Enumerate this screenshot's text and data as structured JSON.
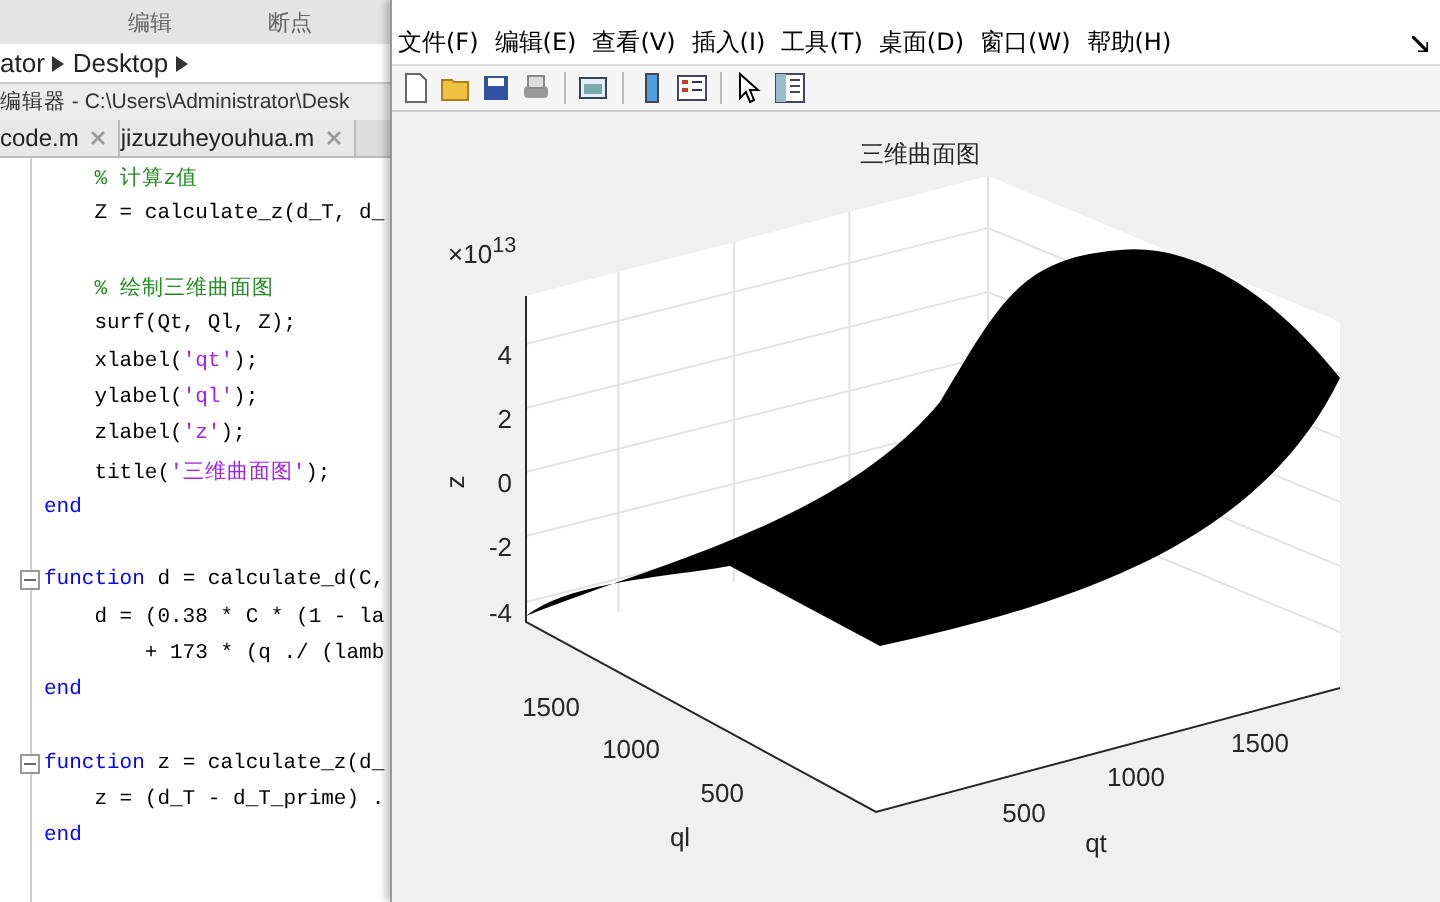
{
  "editor": {
    "toolstrip_sections": [
      "编辑",
      "断点"
    ],
    "breadcrumb": [
      "ator",
      "Desktop"
    ],
    "title": "编辑器 - C:\\Users\\Administrator\\Desk",
    "tabs": [
      {
        "label": "code.m"
      },
      {
        "label": "jizuzuheyouhua.m"
      }
    ],
    "lines": [
      {
        "fold": false,
        "segments": [
          {
            "kind": "comment",
            "text": "    % 计算z值"
          }
        ]
      },
      {
        "fold": false,
        "segments": [
          {
            "kind": "plain",
            "text": "    Z = calculate_z(d_T, d_"
          }
        ]
      },
      {
        "fold": false
      },
      {
        "fold": false,
        "segments": [
          {
            "kind": "comment",
            "text": "    % 绘制三维曲面图"
          }
        ]
      },
      {
        "fold": false,
        "segments": [
          {
            "kind": "plain",
            "text": "    surf(Qt, Ql, Z);"
          }
        ]
      },
      {
        "fold": false,
        "segments": [
          {
            "kind": "plain",
            "text": "    xlabel("
          },
          {
            "kind": "string",
            "text": "'qt'"
          },
          {
            "kind": "plain",
            "text": ");"
          }
        ]
      },
      {
        "fold": false,
        "segments": [
          {
            "kind": "plain",
            "text": "    ylabel("
          },
          {
            "kind": "string",
            "text": "'ql'"
          },
          {
            "kind": "plain",
            "text": ");"
          }
        ]
      },
      {
        "fold": false,
        "segments": [
          {
            "kind": "plain",
            "text": "    zlabel("
          },
          {
            "kind": "string",
            "text": "'z'"
          },
          {
            "kind": "plain",
            "text": ");"
          }
        ]
      },
      {
        "fold": false,
        "segments": [
          {
            "kind": "plain",
            "text": "    title("
          },
          {
            "kind": "string",
            "text": "'三维曲面图'"
          },
          {
            "kind": "plain",
            "text": ");"
          }
        ]
      },
      {
        "fold": false,
        "segments": [
          {
            "kind": "keyword",
            "text": "end"
          }
        ]
      },
      {
        "fold": false
      },
      {
        "fold": true,
        "segments": [
          {
            "kind": "keyword",
            "text": "function"
          },
          {
            "kind": "plain",
            "text": " d = calculate_d(C,"
          }
        ]
      },
      {
        "fold": false,
        "segments": [
          {
            "kind": "plain",
            "text": "    d = (0.38 * C * (1 - la"
          }
        ]
      },
      {
        "fold": false,
        "segments": [
          {
            "kind": "plain",
            "text": "        + 173 * (q ./ (lamb"
          }
        ]
      },
      {
        "fold": false,
        "segments": [
          {
            "kind": "keyword",
            "text": "end"
          }
        ]
      },
      {
        "fold": false
      },
      {
        "fold": true,
        "segments": [
          {
            "kind": "keyword",
            "text": "function"
          },
          {
            "kind": "plain",
            "text": " z = calculate_z(d_"
          }
        ]
      },
      {
        "fold": false,
        "segments": [
          {
            "kind": "plain",
            "text": "    z = (d_T - d_T_prime) ."
          }
        ]
      },
      {
        "fold": false,
        "segments": [
          {
            "kind": "keyword",
            "text": "end"
          }
        ]
      }
    ]
  },
  "figure": {
    "menu": [
      "文件(F)",
      "编辑(E)",
      "查看(V)",
      "插入(I)",
      "工具(T)",
      "桌面(D)",
      "窗口(W)",
      "帮助(H)"
    ],
    "plot": {
      "title": "三维曲面图",
      "exponent": "×10$^{13}$",
      "zlabel": "z",
      "xlabel": "qt",
      "ylabel": "ql",
      "zticks": [
        "4",
        "2",
        "0",
        "-2",
        "-4"
      ],
      "yticks": [
        "1500",
        "1000",
        "500"
      ],
      "xticks": [
        "500",
        "1000",
        "1500"
      ]
    }
  }
}
